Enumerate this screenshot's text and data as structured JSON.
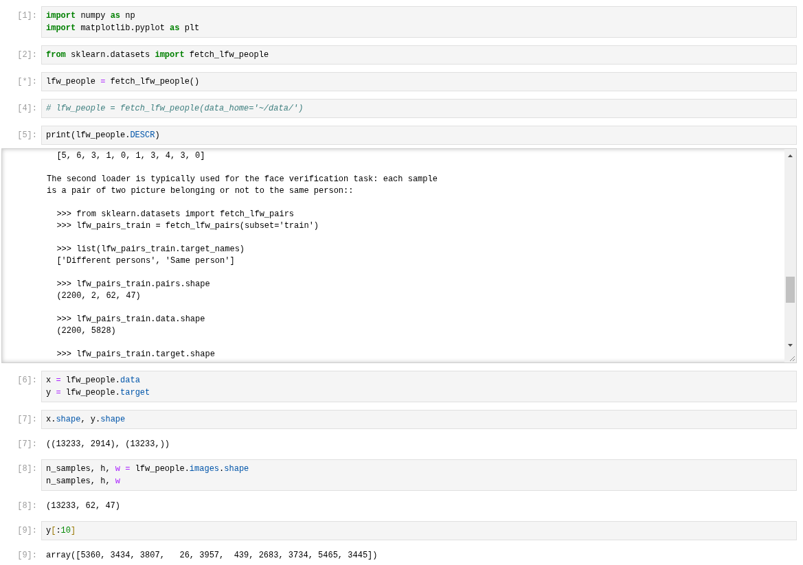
{
  "cells": [
    {
      "kind": "code",
      "prompt": "[1]:",
      "lines": [
        [
          {
            "t": "import",
            "kind": "keyword"
          },
          {
            "t": " numpy ",
            "kind": "plain"
          },
          {
            "t": "as",
            "kind": "keyword"
          },
          {
            "t": " np",
            "kind": "plain"
          }
        ],
        [
          {
            "t": "import",
            "kind": "keyword"
          },
          {
            "t": " matplotlib.pyplot ",
            "kind": "plain"
          },
          {
            "t": "as",
            "kind": "keyword"
          },
          {
            "t": " plt",
            "kind": "plain"
          }
        ]
      ]
    },
    {
      "kind": "code",
      "prompt": "[2]:",
      "lines": [
        [
          {
            "t": "from",
            "kind": "keyword"
          },
          {
            "t": " sklearn.datasets ",
            "kind": "plain"
          },
          {
            "t": "import",
            "kind": "keyword"
          },
          {
            "t": " fetch_lfw_people",
            "kind": "plain"
          }
        ]
      ]
    },
    {
      "kind": "code",
      "prompt": "[*]:",
      "lines": [
        [
          {
            "t": "lfw_people ",
            "kind": "plain"
          },
          {
            "t": "=",
            "kind": "operator"
          },
          {
            "t": " fetch_lfw_people()",
            "kind": "plain"
          }
        ]
      ]
    },
    {
      "kind": "code",
      "prompt": "[4]:",
      "lines": [
        [
          {
            "t": "# lfw_people = fetch_lfw_people(data_home='~/data/')",
            "kind": "comment"
          }
        ]
      ]
    },
    {
      "kind": "code",
      "prompt": "[5]:",
      "lines": [
        [
          {
            "t": "print(lfw_people.",
            "kind": "plain"
          },
          {
            "t": "DESCR",
            "kind": "property"
          },
          {
            "t": ")",
            "kind": "plain"
          }
        ]
      ]
    },
    {
      "kind": "scroll_output",
      "blocks": [
        [
          "  [5, 6, 3, 1, 0, 1, 3, 4, 3, 0]"
        ],
        [
          "The second loader is typically used for the face verification task: each sample",
          "is a pair of two picture belonging or not to the same person::"
        ],
        [
          "  >>> from sklearn.datasets import fetch_lfw_pairs",
          "  >>> lfw_pairs_train = fetch_lfw_pairs(subset='train')"
        ],
        [
          "  >>> list(lfw_pairs_train.target_names)",
          "  ['Different persons', 'Same person']"
        ],
        [
          "  >>> lfw_pairs_train.pairs.shape",
          "  (2200, 2, 62, 47)"
        ],
        [
          "  >>> lfw_pairs_train.data.shape",
          "  (2200, 5828)"
        ],
        [
          "  >>> lfw_pairs_train.target.shape"
        ]
      ]
    },
    {
      "kind": "code",
      "prompt": "[6]:",
      "lines": [
        [
          {
            "t": "x ",
            "kind": "plain"
          },
          {
            "t": "=",
            "kind": "operator"
          },
          {
            "t": " lfw_people.",
            "kind": "plain"
          },
          {
            "t": "data",
            "kind": "property"
          }
        ],
        [
          {
            "t": "y ",
            "kind": "plain"
          },
          {
            "t": "=",
            "kind": "operator"
          },
          {
            "t": " lfw_people.",
            "kind": "plain"
          },
          {
            "t": "target",
            "kind": "property"
          }
        ]
      ]
    },
    {
      "kind": "code",
      "prompt": "[7]:",
      "lines": [
        [
          {
            "t": "x.",
            "kind": "plain"
          },
          {
            "t": "shape",
            "kind": "property"
          },
          {
            "t": ", y.",
            "kind": "plain"
          },
          {
            "t": "shape",
            "kind": "property"
          }
        ]
      ]
    },
    {
      "kind": "result",
      "prompt": "[7]:",
      "lines": [
        "((13233, 2914), (13233,))"
      ]
    },
    {
      "kind": "code",
      "prompt": "[8]:",
      "lines": [
        [
          {
            "t": "n_samples, h, ",
            "kind": "plain"
          },
          {
            "t": "w",
            "kind": "builtin"
          },
          {
            "t": " =",
            "kind": "operator"
          },
          {
            "t": " lfw_people.",
            "kind": "plain"
          },
          {
            "t": "images",
            "kind": "property"
          },
          {
            "t": ".",
            "kind": "plain"
          },
          {
            "t": "shape",
            "kind": "property"
          }
        ],
        [
          {
            "t": "n_samples, h, ",
            "kind": "plain"
          },
          {
            "t": "w",
            "kind": "builtin"
          }
        ]
      ]
    },
    {
      "kind": "result",
      "prompt": "[8]:",
      "lines": [
        "(13233, 62, 47)"
      ]
    },
    {
      "kind": "code",
      "prompt": "[9]:",
      "lines": [
        [
          {
            "t": "y",
            "kind": "plain"
          },
          {
            "t": "[",
            "kind": "bracket"
          },
          {
            "t": ":",
            "kind": "plain"
          },
          {
            "t": "10",
            "kind": "number"
          },
          {
            "t": "]",
            "kind": "bracket"
          }
        ]
      ]
    },
    {
      "kind": "result",
      "prompt": "[9]:",
      "lines": [
        "array([5360, 3434, 3807,   26, 3957,  439, 2683, 3734, 5465, 3445])"
      ]
    }
  ]
}
